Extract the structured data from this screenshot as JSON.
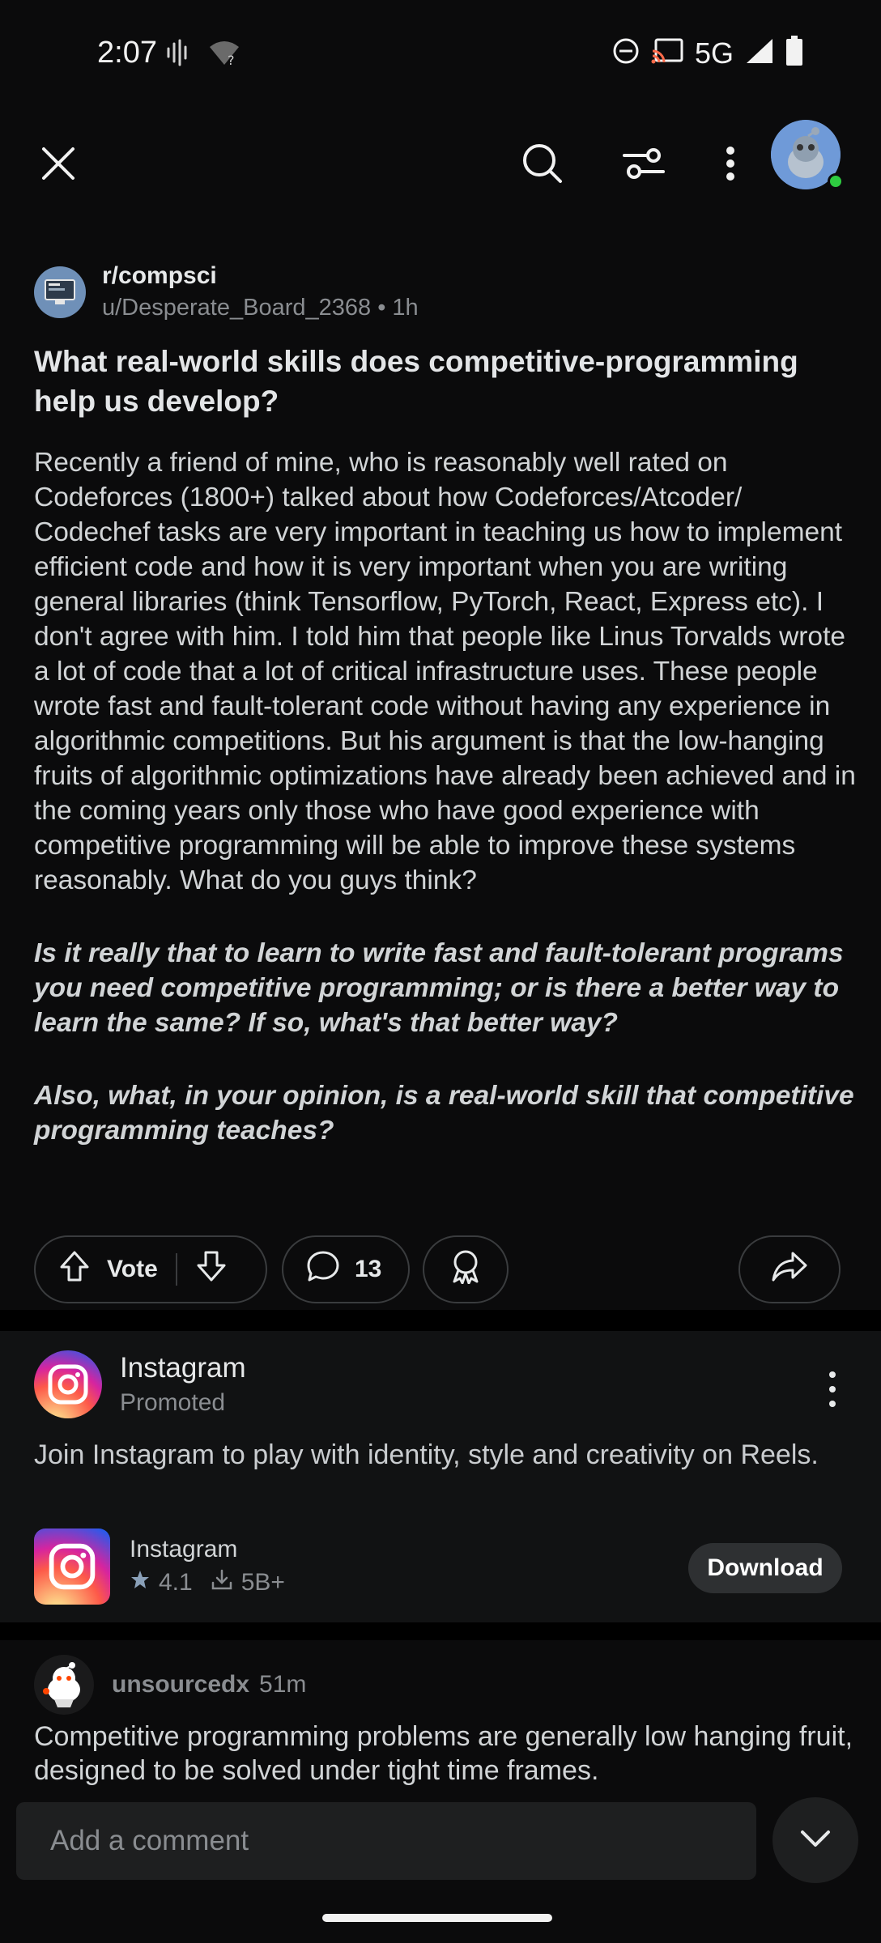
{
  "status_bar": {
    "time": "2:07",
    "network": "5G",
    "icons": [
      "voicemail-icon",
      "wifi-question-icon",
      "dnd-icon",
      "cast-icon",
      "signal-icon",
      "battery-icon"
    ]
  },
  "app_bar": {
    "icons": [
      "close-icon",
      "search-icon",
      "filter-icon",
      "more-vertical-icon",
      "avatar"
    ]
  },
  "post": {
    "subreddit": "r/compsci",
    "meta": "u/Desperate_Board_2368 • 1h",
    "title": "What real-world skills does competitive-programming help us develop?",
    "body_paragraphs": [
      "Recently a friend of mine, who is reasonably well rated on Codeforces (1800+) talked about how Codeforces/Atcoder/ Codechef tasks are very important in teaching us how to implement efficient code and how it is very important when you are writing general libraries (think Tensorflow, PyTorch, React, Express etc). I don't agree with him. I told him that people like Linus Torvalds wrote a lot of code that a lot of critical infrastructure uses. These people wrote fast and fault-tolerant code without having any experience in algorithmic competitions. But his argument is that the low-hanging fruits of algorithmic optimizations have already been achieved and in the coming years only those who have good experience with competitive programming will be able to improve these systems reasonably. What do you guys think?",
      "Is it really that to learn to write fast and fault-tolerant programs you need competitive programming; or is there a better way to learn the same? If so, what's that better way?",
      "Also, what, in your opinion, is a real-world skill that competitive programming teaches?"
    ],
    "vote_label": "Vote",
    "comment_count": "13"
  },
  "ad": {
    "name": "Instagram",
    "promoted": "Promoted",
    "text": "Join Instagram to play with identity, style and creativity on Reels.",
    "app_name": "Instagram",
    "rating": "4.1",
    "downloads": "5B+",
    "download_label": "Download"
  },
  "comment": {
    "user": "unsourcedx",
    "time": "51m",
    "text": "Competitive programming problems are generally low hanging fruit, designed to be solved under tight time frames."
  },
  "composer": {
    "placeholder": "Add a comment"
  }
}
